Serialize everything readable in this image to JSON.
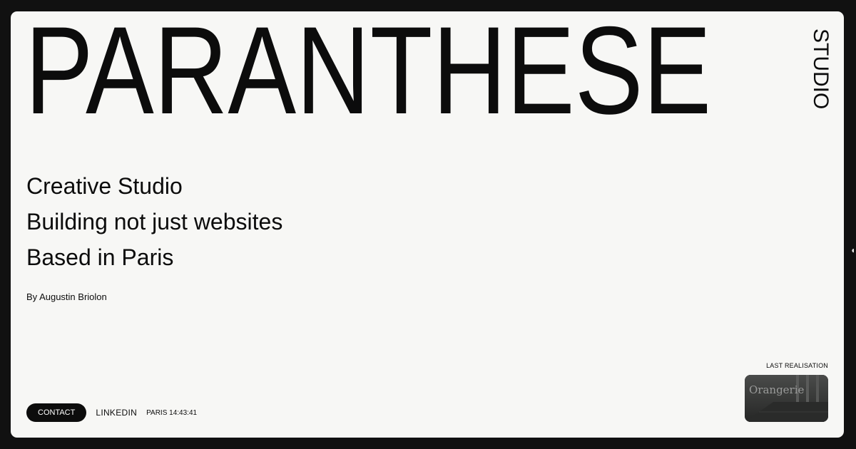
{
  "header": {
    "logo": "PARANTHESE",
    "logo_sub": "STUDIO"
  },
  "hero": {
    "lines": [
      "Creative Studio",
      "Building not just websites",
      "Based in Paris"
    ],
    "byline": "By Augustin Briolon"
  },
  "footer": {
    "contact_label": "CONTACT",
    "linkedin_label": "LINKEDIN",
    "clock_text": "PARIS 14:43:41"
  },
  "realisation": {
    "label": "LAST REALISATION",
    "thumbnail_text": "Orangerie"
  },
  "colors": {
    "background_frame": "#111111",
    "card": "#f7f7f5",
    "text": "#0c0c0c",
    "button_bg": "#0c0c0c",
    "button_text": "#ffffff"
  },
  "icons": {
    "edge_glyph": "cursor-edge-icon"
  }
}
